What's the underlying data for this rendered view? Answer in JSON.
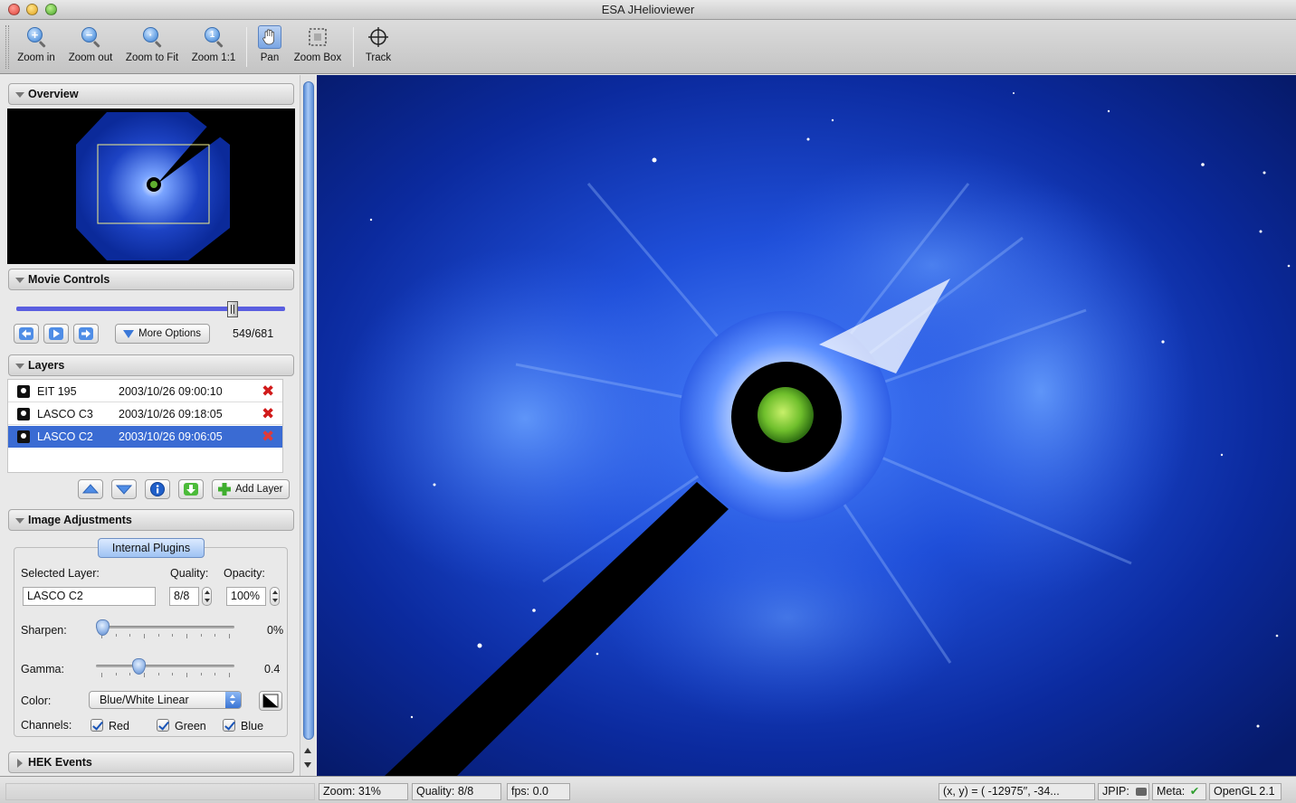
{
  "window": {
    "title": "ESA JHelioviewer"
  },
  "toolbar": {
    "zoom_in": "Zoom in",
    "zoom_out": "Zoom out",
    "zoom_fit": "Zoom to Fit",
    "zoom_1to1": "Zoom 1:1",
    "pan": "Pan",
    "zoom_box": "Zoom Box",
    "track": "Track"
  },
  "sections": {
    "overview": "Overview",
    "movie_controls": "Movie Controls",
    "layers": "Layers",
    "image_adjustments": "Image Adjustments",
    "hek_events": "HEK Events"
  },
  "movie": {
    "more_options": "More Options",
    "frame_counter": "549/681",
    "current_frame": 549,
    "total_frames": 681
  },
  "layers": [
    {
      "name": "EIT 195",
      "timestamp": "2003/10/26 09:00:10",
      "selected": false
    },
    {
      "name": "LASCO C3",
      "timestamp": "2003/10/26 09:18:05",
      "selected": false
    },
    {
      "name": "LASCO C2",
      "timestamp": "2003/10/26 09:06:05",
      "selected": true
    }
  ],
  "layer_buttons": {
    "add_layer": "Add Layer"
  },
  "adjustments": {
    "tab": "Internal Plugins",
    "selected_layer_label": "Selected Layer:",
    "selected_layer_value": "LASCO C2",
    "quality_label": "Quality:",
    "quality_value": "8/8",
    "opacity_label": "Opacity:",
    "opacity_value": "100%",
    "sharpen_label": "Sharpen:",
    "sharpen_value": "0%",
    "sharpen_level": 0.0,
    "gamma_label": "Gamma:",
    "gamma_value": "0.4",
    "gamma_level": 0.29,
    "color_label": "Color:",
    "color_value": "Blue/White Linear",
    "channels_label": "Channels:",
    "channel_red": "Red",
    "channel_green": "Green",
    "channel_blue": "Blue"
  },
  "status": {
    "zoom": "Zoom: 31%",
    "quality": "Quality: 8/8",
    "fps": "fps: 0.0",
    "coords": "(x, y) = ( -12975′′,  -34...",
    "jpip": "JPIP:",
    "meta": "Meta:",
    "opengl": "OpenGL 2.1"
  },
  "colors": {
    "accent": "#3a6bd3",
    "viewport_bg": "#07195e"
  }
}
